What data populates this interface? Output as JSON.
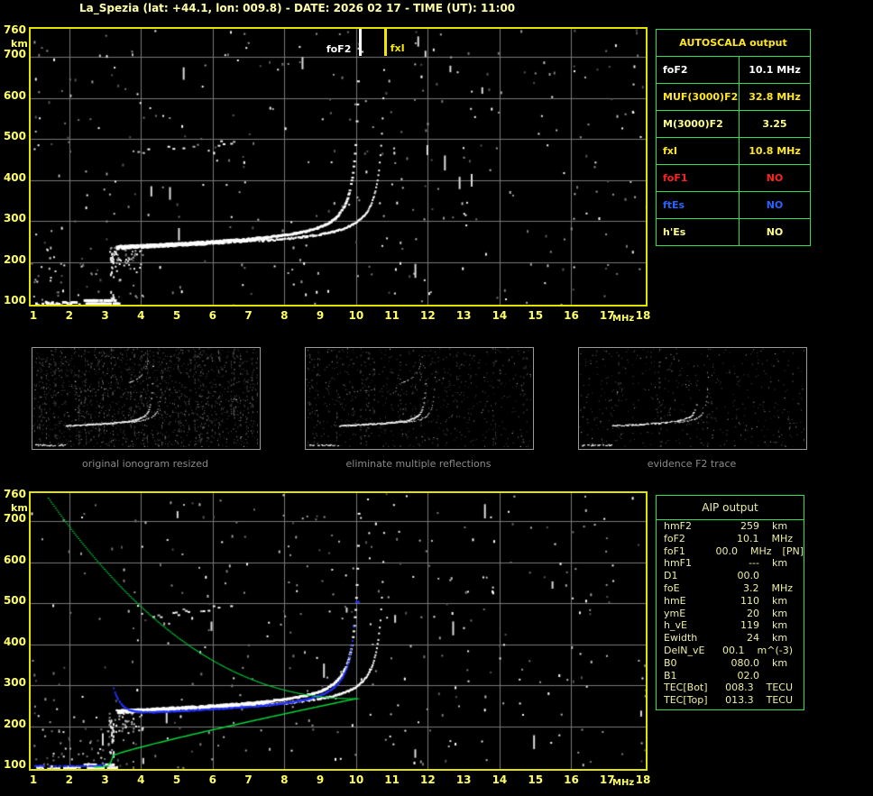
{
  "title": "La_Spezia (lat: +44.1, lon: 009.8) - DATE: 2026 02 17 - TIME (UT): 11:00",
  "autoscala_table": {
    "header": "AUTOSCALA output",
    "header_color": "#ffe81e",
    "border_color": "#2ee24e",
    "rows": [
      {
        "label": "foF2",
        "value": "10.1 MHz",
        "color": "#ffffff"
      },
      {
        "label": "MUF(3000)F2",
        "value": "32.8 MHz",
        "color": "#ffe81e"
      },
      {
        "label": "M(3000)F2",
        "value": "3.25",
        "color": "#ffff8c"
      },
      {
        "label": "fxI",
        "value": "10.8 MHz",
        "color": "#ffe81e"
      },
      {
        "label": "foF1",
        "value": "NO",
        "color": "#ff2222"
      },
      {
        "label": "ftEs",
        "value": "NO",
        "color": "#2864ff"
      },
      {
        "label": "h'Es",
        "value": "NO",
        "color": "#ffff8c"
      }
    ]
  },
  "aip_table": {
    "header": "AIP output",
    "text_color": "#eeeea6",
    "border_color": "#2ee24e",
    "rows": [
      {
        "label": "hmF2",
        "value": "259",
        "unit": "km",
        "extra": ""
      },
      {
        "label": "foF2",
        "value": "10.1",
        "unit": "MHz",
        "extra": ""
      },
      {
        "label": "foF1",
        "value": "00.0",
        "unit": "MHz",
        "extra": "[PN]"
      },
      {
        "label": "hmF1",
        "value": "---",
        "unit": "km",
        "extra": ""
      },
      {
        "label": "D1",
        "value": "00.0",
        "unit": "",
        "extra": ""
      },
      {
        "label": "foE",
        "value": "3.2",
        "unit": "MHz",
        "extra": ""
      },
      {
        "label": "hmE",
        "value": "110",
        "unit": "km",
        "extra": ""
      },
      {
        "label": "ymE",
        "value": "20",
        "unit": "km",
        "extra": ""
      },
      {
        "label": "h_vE",
        "value": "119",
        "unit": "km",
        "extra": ""
      },
      {
        "label": "Ewidth",
        "value": "24",
        "unit": "km",
        "extra": ""
      },
      {
        "label": "DelN_vE",
        "value": "00.1",
        "unit": "m^(-3)",
        "extra": ""
      },
      {
        "label": "B0",
        "value": "080.0",
        "unit": "km",
        "extra": ""
      },
      {
        "label": "B1",
        "value": "02.0",
        "unit": "",
        "extra": ""
      },
      {
        "label": "TEC[Bot]",
        "value": "008.3",
        "unit": "TECU",
        "extra": ""
      },
      {
        "label": "TEC[Top]",
        "value": "013.3",
        "unit": "TECU",
        "extra": ""
      }
    ]
  },
  "thumbnails": [
    {
      "caption": "original ionogram resized"
    },
    {
      "caption": "eliminate multiple reflections"
    },
    {
      "caption": "evidence F2 trace"
    }
  ],
  "chart_data": {
    "type": "scatter",
    "description": "Two ionograms (virtual height km vs frequency MHz): top = autoscaled ionogram with foF2/fxI markers; bottom = ionogram with scaled trace (blue dots) and electron density profile (green)",
    "xlabel": "MHz",
    "ylabel": "km",
    "x_ticks": [
      1,
      2,
      3,
      4,
      5,
      6,
      7,
      8,
      9,
      10,
      11,
      12,
      13,
      14,
      15,
      16,
      17,
      18
    ],
    "y_ticks": [
      760,
      700,
      600,
      500,
      400,
      300,
      200,
      100
    ],
    "xlim": [
      1,
      18
    ],
    "ylim": [
      100,
      760
    ],
    "grid": "gray, vertical every 2 MHz, horizontal every 100 km",
    "markers": {
      "foF2": {
        "label": "foF2",
        "mhz": 10.1,
        "color": "#ffffff"
      },
      "fxI": {
        "label": "fxI",
        "mhz": 10.8,
        "color": "#f2e500"
      }
    },
    "trace_model": {
      "f_min": 3.3,
      "h_min": 237,
      "foF2": 10.1,
      "fxI": 10.8,
      "foE": 3.2,
      "hmF2": 259,
      "e_layer_height": 105,
      "second_hop_height_factor": 2
    },
    "colors": {
      "echo_trace": "#ffffff",
      "scaled_trace": "#2233ff",
      "profile": "#00d83c",
      "grid": "#7a7a7a",
      "axis_border": "#e3e300",
      "axis_text": "#ffff66"
    }
  }
}
